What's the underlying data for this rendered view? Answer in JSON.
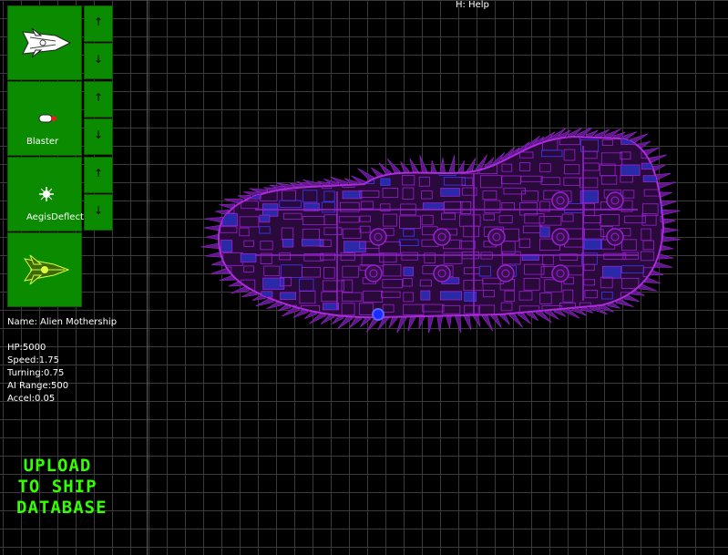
{
  "help": {
    "label": "H: Help"
  },
  "palette": [
    {
      "slot": "hull",
      "label": ""
    },
    {
      "slot": "weapon",
      "label": "Blaster"
    },
    {
      "slot": "shield",
      "label": "AegisDeflecto"
    },
    {
      "slot": "engine",
      "label": ""
    }
  ],
  "arrows": {
    "up": "↑",
    "down": "↓"
  },
  "ship": {
    "name_line": "Name: Alien Mothership",
    "stats": {
      "hp": "HP:5000",
      "speed": "Speed:1.75",
      "turning": "Turning:0.75",
      "ai_range": "AI Range:500",
      "accel": "Accel:0.05"
    }
  },
  "upload": {
    "line1": "UPLOAD",
    "line2": "TO SHIP",
    "line3": "DATABASE"
  },
  "colors": {
    "panel_green": "#0b8c00",
    "upload_green": "#33ff00",
    "ship_purple": "#9b1fd6",
    "ship_blue": "#3b3bff",
    "grid": "#3a3a3a"
  }
}
